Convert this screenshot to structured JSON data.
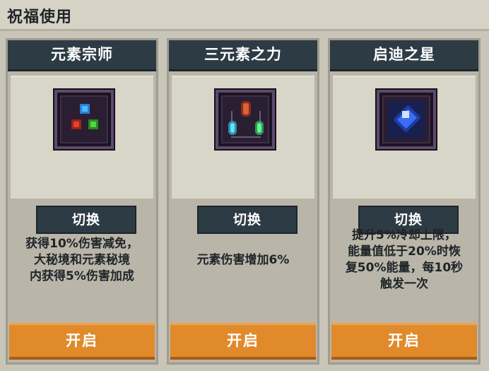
{
  "title": "祝福使用",
  "cards": [
    {
      "name": "元素宗师",
      "icon": "three-element-gems-icon",
      "switch_label": "切换",
      "description": "获得10%伤害减免，\n大秘境和元素秘境\n内获得5%伤害加成",
      "open_label": "开启"
    },
    {
      "name": "三元素之力",
      "icon": "three-element-crystals-icon",
      "switch_label": "切换",
      "description": "元素伤害增加6%",
      "open_label": "开启"
    },
    {
      "name": "启迪之星",
      "icon": "blue-star-gem-icon",
      "switch_label": "切换",
      "description": "提升5%冷却上限，\n能量值低于20%时恢\n复50%能量，每10秒\n触发一次",
      "open_label": "开启"
    }
  ],
  "colors": {
    "header_bg": "#2d3b44",
    "open_button": "#e08a2c",
    "panel_bg": "#b9b6a9"
  }
}
